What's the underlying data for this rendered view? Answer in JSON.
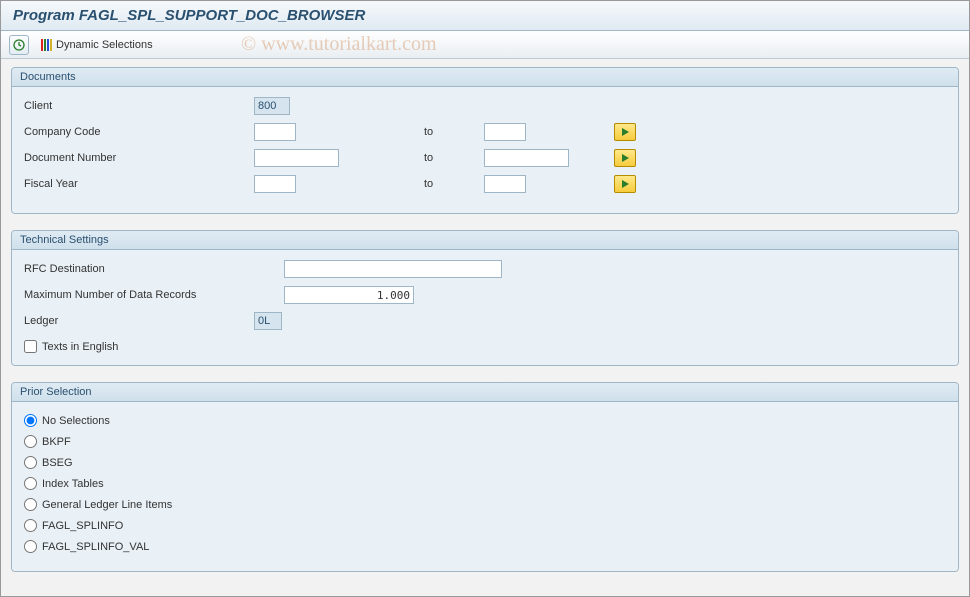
{
  "title": "Program FAGL_SPL_SUPPORT_DOC_BROWSER",
  "toolbar": {
    "dynamic_selections_label": "Dynamic Selections"
  },
  "watermark": "© www.tutorialkart.com",
  "documents_group": {
    "title": "Documents",
    "client_label": "Client",
    "client_value": "800",
    "company_code_label": "Company Code",
    "company_code_from": "",
    "company_code_to": "",
    "document_number_label": "Document Number",
    "document_number_from": "",
    "document_number_to": "",
    "fiscal_year_label": "Fiscal Year",
    "fiscal_year_from": "",
    "fiscal_year_to": "",
    "to_label": "to"
  },
  "technical_group": {
    "title": "Technical Settings",
    "rfc_label": "RFC Destination",
    "rfc_value": "",
    "max_records_label": "Maximum Number of Data Records",
    "max_records_value": "1.000",
    "ledger_label": "Ledger",
    "ledger_value": "0L",
    "texts_english_label": "Texts in English",
    "texts_english_checked": false
  },
  "prior_group": {
    "title": "Prior Selection",
    "options": [
      {
        "label": "No Selections",
        "checked": true
      },
      {
        "label": "BKPF",
        "checked": false
      },
      {
        "label": "BSEG",
        "checked": false
      },
      {
        "label": "Index Tables",
        "checked": false
      },
      {
        "label": "General Ledger Line Items",
        "checked": false
      },
      {
        "label": "FAGL_SPLINFO",
        "checked": false
      },
      {
        "label": "FAGL_SPLINFO_VAL",
        "checked": false
      }
    ]
  }
}
